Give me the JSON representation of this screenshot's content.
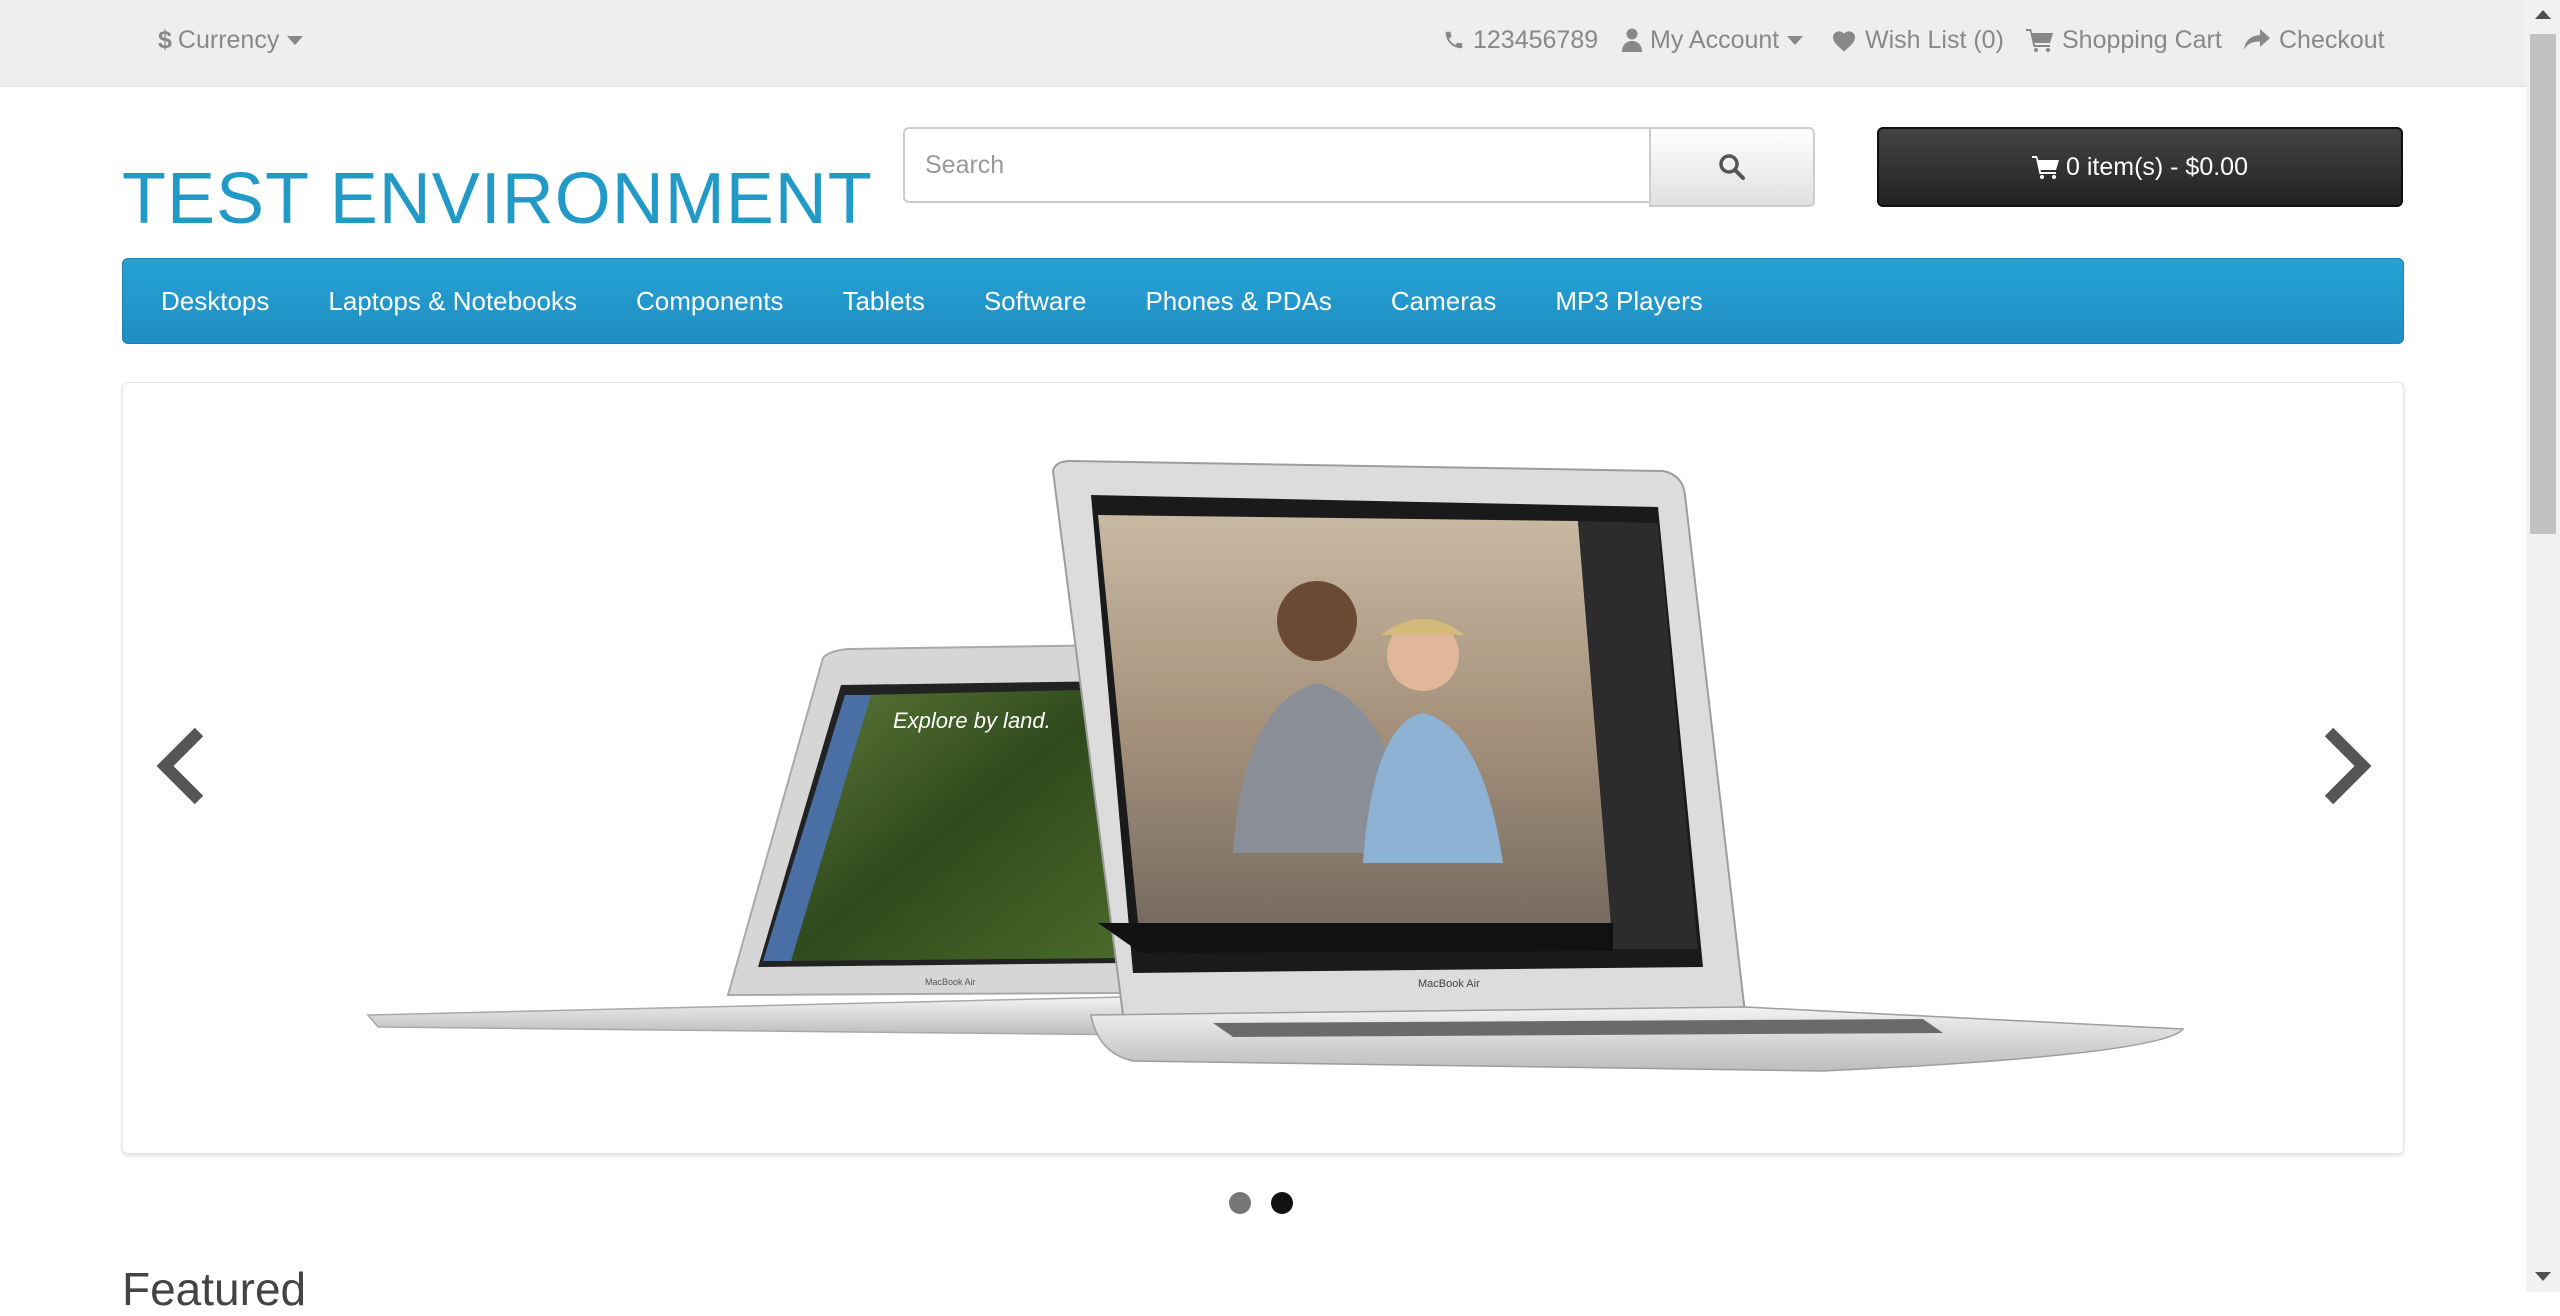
{
  "top_bar": {
    "currency_symbol": "$",
    "currency_label": "Currency",
    "phone": "123456789",
    "my_account": "My Account",
    "wishlist": "Wish List (0)",
    "shopping_cart": "Shopping Cart",
    "checkout": "Checkout"
  },
  "header": {
    "logo": "TEST ENVIRONMENT",
    "search_placeholder": "Search",
    "cart_label": "0 item(s) - $0.00"
  },
  "menu": {
    "items": [
      "Desktops",
      "Laptops & Notebooks",
      "Components",
      "Tablets",
      "Software",
      "Phones & PDAs",
      "Cameras",
      "MP3 Players"
    ]
  },
  "slideshow": {
    "pager_count": 2,
    "active_index": 1,
    "slide_text": "Explore by land.",
    "brand_text": "MacBook Air"
  },
  "featured_heading": "Featured",
  "colors": {
    "brand": "#229ac8",
    "menu_bg": "#229ac8",
    "cart_bg": "#333333",
    "top_bar_bg": "#eeeeee"
  },
  "icons": [
    "dollar-icon",
    "phone-icon",
    "user-icon",
    "heart-icon",
    "cart-icon",
    "share-icon",
    "search-icon",
    "chevron-left-icon",
    "chevron-right-icon"
  ]
}
